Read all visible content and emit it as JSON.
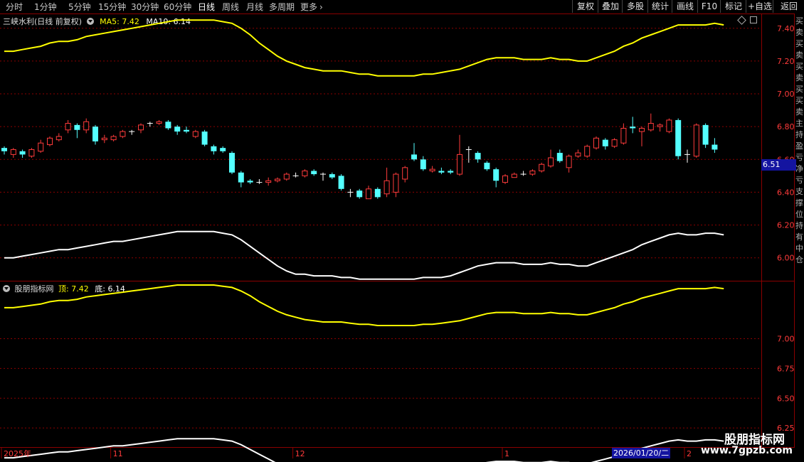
{
  "toolbar": {
    "timeframes": [
      "分时",
      "1分钟",
      "5分钟",
      "15分钟",
      "30分钟",
      "60分钟",
      "日线",
      "周线",
      "月线",
      "多周期",
      "更多"
    ],
    "active_timeframe": "日线",
    "right_buttons": [
      "复权",
      "叠加",
      "多股",
      "统计",
      "画线",
      "F10",
      "标记",
      "+自选",
      "返回"
    ]
  },
  "main_panel": {
    "title": "三峡水利(日线 前复权)",
    "ma5_label": "MA5:",
    "ma5_value": "7.42",
    "ma10_label": "MA10:",
    "ma10_value": "6.14",
    "current_price": "6.51"
  },
  "sub_panel": {
    "title": "股朋指标网",
    "top_label": "顶:",
    "top_value": "7.42",
    "bottom_label": "底:",
    "bottom_value": "6.14"
  },
  "x_axis": {
    "labels": [
      "2025年",
      "11",
      "12",
      "1",
      "2"
    ],
    "selected_date": "2026/01/20/二"
  },
  "right_strip_text": "买卖买卖买卖买买卖主持盈亏净亏支撑位持有中仓",
  "watermark": {
    "line1": "股朋指标网",
    "line2": "www.7gpzb.com"
  },
  "colors": {
    "up": "#ff3b3b",
    "down": "#54ffff",
    "upper_band": "#ffff00",
    "lower_band": "#ffffff",
    "grid": "#8b0000",
    "axis_text": "#ff3b3b"
  },
  "chart_data": [
    {
      "type": "candlestick",
      "title": "三峡水利(日线 前复权)",
      "y_ticks": [
        6.0,
        6.2,
        6.4,
        6.6,
        6.8,
        7.0,
        7.2,
        7.4
      ],
      "ylim": [
        5.86,
        7.49
      ],
      "x_ticks": [
        "2025年",
        "11",
        "12",
        "1",
        "2"
      ],
      "candles": [
        [
          6.67,
          6.65,
          6.68,
          6.63
        ],
        [
          6.63,
          6.66,
          6.67,
          6.61
        ],
        [
          6.65,
          6.63,
          6.66,
          6.61
        ],
        [
          6.62,
          6.66,
          6.67,
          6.61
        ],
        [
          6.65,
          6.7,
          6.72,
          6.64
        ],
        [
          6.69,
          6.73,
          6.74,
          6.68
        ],
        [
          6.72,
          6.74,
          6.76,
          6.71
        ],
        [
          6.78,
          6.82,
          6.84,
          6.76
        ],
        [
          6.81,
          6.78,
          6.82,
          6.73
        ],
        [
          6.78,
          6.83,
          6.85,
          6.76
        ],
        [
          6.8,
          6.71,
          6.81,
          6.69
        ],
        [
          6.72,
          6.73,
          6.75,
          6.7
        ],
        [
          6.72,
          6.74,
          6.75,
          6.71
        ],
        [
          6.74,
          6.77,
          6.78,
          6.73
        ],
        [
          6.77,
          6.77,
          6.78,
          6.75
        ],
        [
          6.78,
          6.81,
          6.82,
          6.76
        ],
        [
          6.82,
          6.82,
          6.83,
          6.8
        ],
        [
          6.82,
          6.83,
          6.84,
          6.81
        ],
        [
          6.83,
          6.79,
          6.84,
          6.78
        ],
        [
          6.8,
          6.77,
          6.81,
          6.75
        ],
        [
          6.78,
          6.77,
          6.8,
          6.76
        ],
        [
          6.74,
          6.77,
          6.78,
          6.73
        ],
        [
          6.77,
          6.69,
          6.78,
          6.68
        ],
        [
          6.68,
          6.65,
          6.69,
          6.63
        ],
        [
          6.67,
          6.65,
          6.68,
          6.64
        ],
        [
          6.64,
          6.52,
          6.65,
          6.51
        ],
        [
          6.52,
          6.46,
          6.53,
          6.43
        ],
        [
          6.47,
          6.46,
          6.48,
          6.45
        ],
        [
          6.46,
          6.46,
          6.48,
          6.45
        ],
        [
          6.46,
          6.47,
          6.49,
          6.44
        ],
        [
          6.47,
          6.48,
          6.49,
          6.46
        ],
        [
          6.48,
          6.51,
          6.52,
          6.47
        ],
        [
          6.5,
          6.5,
          6.52,
          6.49
        ],
        [
          6.5,
          6.53,
          6.54,
          6.49
        ],
        [
          6.53,
          6.51,
          6.54,
          6.5
        ],
        [
          6.51,
          6.51,
          6.52,
          6.47
        ],
        [
          6.51,
          6.49,
          6.52,
          6.48
        ],
        [
          6.5,
          6.42,
          6.51,
          6.41
        ],
        [
          6.4,
          6.4,
          6.42,
          6.37
        ],
        [
          6.41,
          6.37,
          6.42,
          6.36
        ],
        [
          6.36,
          6.42,
          6.44,
          6.36
        ],
        [
          6.42,
          6.37,
          6.43,
          6.36
        ],
        [
          6.39,
          6.47,
          6.55,
          6.37
        ],
        [
          6.4,
          6.51,
          6.52,
          6.37
        ],
        [
          6.48,
          6.55,
          6.56,
          6.46
        ],
        [
          6.63,
          6.6,
          6.7,
          6.59
        ],
        [
          6.6,
          6.54,
          6.62,
          6.53
        ],
        [
          6.53,
          6.54,
          6.56,
          6.52
        ],
        [
          6.53,
          6.52,
          6.55,
          6.51
        ],
        [
          6.53,
          6.52,
          6.54,
          6.51
        ],
        [
          6.51,
          6.63,
          6.75,
          6.5
        ],
        [
          6.66,
          6.66,
          6.68,
          6.58
        ],
        [
          6.64,
          6.6,
          6.65,
          6.58
        ],
        [
          6.58,
          6.54,
          6.59,
          6.53
        ],
        [
          6.54,
          6.47,
          6.55,
          6.43
        ],
        [
          6.46,
          6.5,
          6.51,
          6.45
        ],
        [
          6.49,
          6.51,
          6.52,
          6.49
        ],
        [
          6.51,
          6.51,
          6.53,
          6.5
        ],
        [
          6.51,
          6.53,
          6.54,
          6.5
        ],
        [
          6.53,
          6.57,
          6.58,
          6.52
        ],
        [
          6.56,
          6.61,
          6.66,
          6.55
        ],
        [
          6.64,
          6.59,
          6.66,
          6.58
        ],
        [
          6.55,
          6.62,
          6.63,
          6.52
        ],
        [
          6.62,
          6.64,
          6.66,
          6.61
        ],
        [
          6.62,
          6.68,
          6.69,
          6.61
        ],
        [
          6.67,
          6.73,
          6.74,
          6.66
        ],
        [
          6.72,
          6.68,
          6.73,
          6.66
        ],
        [
          6.68,
          6.72,
          6.73,
          6.67
        ],
        [
          6.7,
          6.79,
          6.82,
          6.69
        ],
        [
          6.8,
          6.79,
          6.86,
          6.76
        ],
        [
          6.77,
          6.79,
          6.8,
          6.68
        ],
        [
          6.78,
          6.82,
          6.88,
          6.77
        ],
        [
          6.8,
          6.81,
          6.82,
          6.77
        ],
        [
          6.77,
          6.84,
          6.85,
          6.76
        ],
        [
          6.84,
          6.62,
          6.85,
          6.6
        ],
        [
          6.63,
          6.63,
          6.66,
          6.58
        ],
        [
          6.62,
          6.81,
          6.82,
          6.61
        ],
        [
          6.81,
          6.69,
          6.82,
          6.67
        ],
        [
          6.69,
          6.66,
          6.73,
          6.64
        ]
      ],
      "ma_upper": [
        7.26,
        7.26,
        7.27,
        7.28,
        7.29,
        7.31,
        7.32,
        7.32,
        7.33,
        7.35,
        7.36,
        7.37,
        7.38,
        7.39,
        7.4,
        7.41,
        7.42,
        7.43,
        7.44,
        7.45,
        7.45,
        7.45,
        7.45,
        7.45,
        7.44,
        7.43,
        7.4,
        7.36,
        7.31,
        7.27,
        7.23,
        7.2,
        7.18,
        7.16,
        7.15,
        7.14,
        7.14,
        7.14,
        7.13,
        7.12,
        7.12,
        7.11,
        7.11,
        7.11,
        7.11,
        7.11,
        7.12,
        7.12,
        7.13,
        7.14,
        7.15,
        7.17,
        7.19,
        7.21,
        7.22,
        7.22,
        7.22,
        7.21,
        7.21,
        7.21,
        7.22,
        7.21,
        7.21,
        7.2,
        7.2,
        7.22,
        7.24,
        7.26,
        7.29,
        7.31,
        7.34,
        7.36,
        7.38,
        7.4,
        7.42,
        7.42,
        7.42,
        7.42,
        7.43,
        7.42
      ],
      "ma_lower": [
        6.0,
        6.0,
        6.01,
        6.02,
        6.03,
        6.04,
        6.05,
        6.05,
        6.06,
        6.07,
        6.08,
        6.09,
        6.1,
        6.1,
        6.11,
        6.12,
        6.13,
        6.14,
        6.15,
        6.16,
        6.16,
        6.16,
        6.16,
        6.16,
        6.15,
        6.14,
        6.11,
        6.07,
        6.03,
        5.99,
        5.95,
        5.92,
        5.9,
        5.9,
        5.89,
        5.89,
        5.89,
        5.88,
        5.88,
        5.87,
        5.87,
        5.87,
        5.87,
        5.87,
        5.87,
        5.87,
        5.88,
        5.88,
        5.88,
        5.89,
        5.91,
        5.93,
        5.95,
        5.96,
        5.97,
        5.97,
        5.97,
        5.96,
        5.96,
        5.96,
        5.97,
        5.96,
        5.96,
        5.95,
        5.95,
        5.97,
        5.99,
        6.01,
        6.03,
        6.05,
        6.08,
        6.1,
        6.12,
        6.14,
        6.15,
        6.14,
        6.14,
        6.15,
        6.15,
        6.14
      ]
    },
    {
      "type": "line",
      "title": "股朋指标网",
      "y_ticks": [
        6.25,
        6.5,
        6.75,
        7.0
      ],
      "ylim": [
        6.09,
        7.48
      ],
      "series": [
        {
          "name": "顶",
          "color": "#ffff00",
          "values": [
            7.26,
            7.26,
            7.27,
            7.28,
            7.29,
            7.31,
            7.32,
            7.32,
            7.33,
            7.35,
            7.36,
            7.37,
            7.38,
            7.39,
            7.4,
            7.41,
            7.42,
            7.43,
            7.44,
            7.45,
            7.45,
            7.45,
            7.45,
            7.45,
            7.44,
            7.43,
            7.4,
            7.36,
            7.31,
            7.27,
            7.23,
            7.2,
            7.18,
            7.16,
            7.15,
            7.14,
            7.14,
            7.14,
            7.13,
            7.12,
            7.12,
            7.11,
            7.11,
            7.11,
            7.11,
            7.11,
            7.12,
            7.12,
            7.13,
            7.14,
            7.15,
            7.17,
            7.19,
            7.21,
            7.22,
            7.22,
            7.22,
            7.21,
            7.21,
            7.21,
            7.22,
            7.21,
            7.21,
            7.2,
            7.2,
            7.22,
            7.24,
            7.26,
            7.29,
            7.31,
            7.34,
            7.36,
            7.38,
            7.4,
            7.42,
            7.42,
            7.42,
            7.42,
            7.43,
            7.42
          ]
        },
        {
          "name": "底",
          "color": "#ffffff",
          "values": [
            6.0,
            6.0,
            6.01,
            6.02,
            6.03,
            6.04,
            6.05,
            6.05,
            6.06,
            6.07,
            6.08,
            6.09,
            6.1,
            6.1,
            6.11,
            6.12,
            6.13,
            6.14,
            6.15,
            6.16,
            6.16,
            6.16,
            6.16,
            6.16,
            6.15,
            6.14,
            6.11,
            6.07,
            6.03,
            5.99,
            5.95,
            5.92,
            5.9,
            5.9,
            5.89,
            5.89,
            5.89,
            5.88,
            5.88,
            5.87,
            5.87,
            5.87,
            5.87,
            5.87,
            5.87,
            5.87,
            5.88,
            5.88,
            5.88,
            5.89,
            5.91,
            5.93,
            5.95,
            5.96,
            5.97,
            5.97,
            5.97,
            5.96,
            5.96,
            5.96,
            5.97,
            5.96,
            5.96,
            5.95,
            5.95,
            5.97,
            5.99,
            6.01,
            6.03,
            6.05,
            6.08,
            6.1,
            6.12,
            6.14,
            6.15,
            6.14,
            6.14,
            6.15,
            6.15,
            6.14
          ]
        }
      ]
    }
  ]
}
